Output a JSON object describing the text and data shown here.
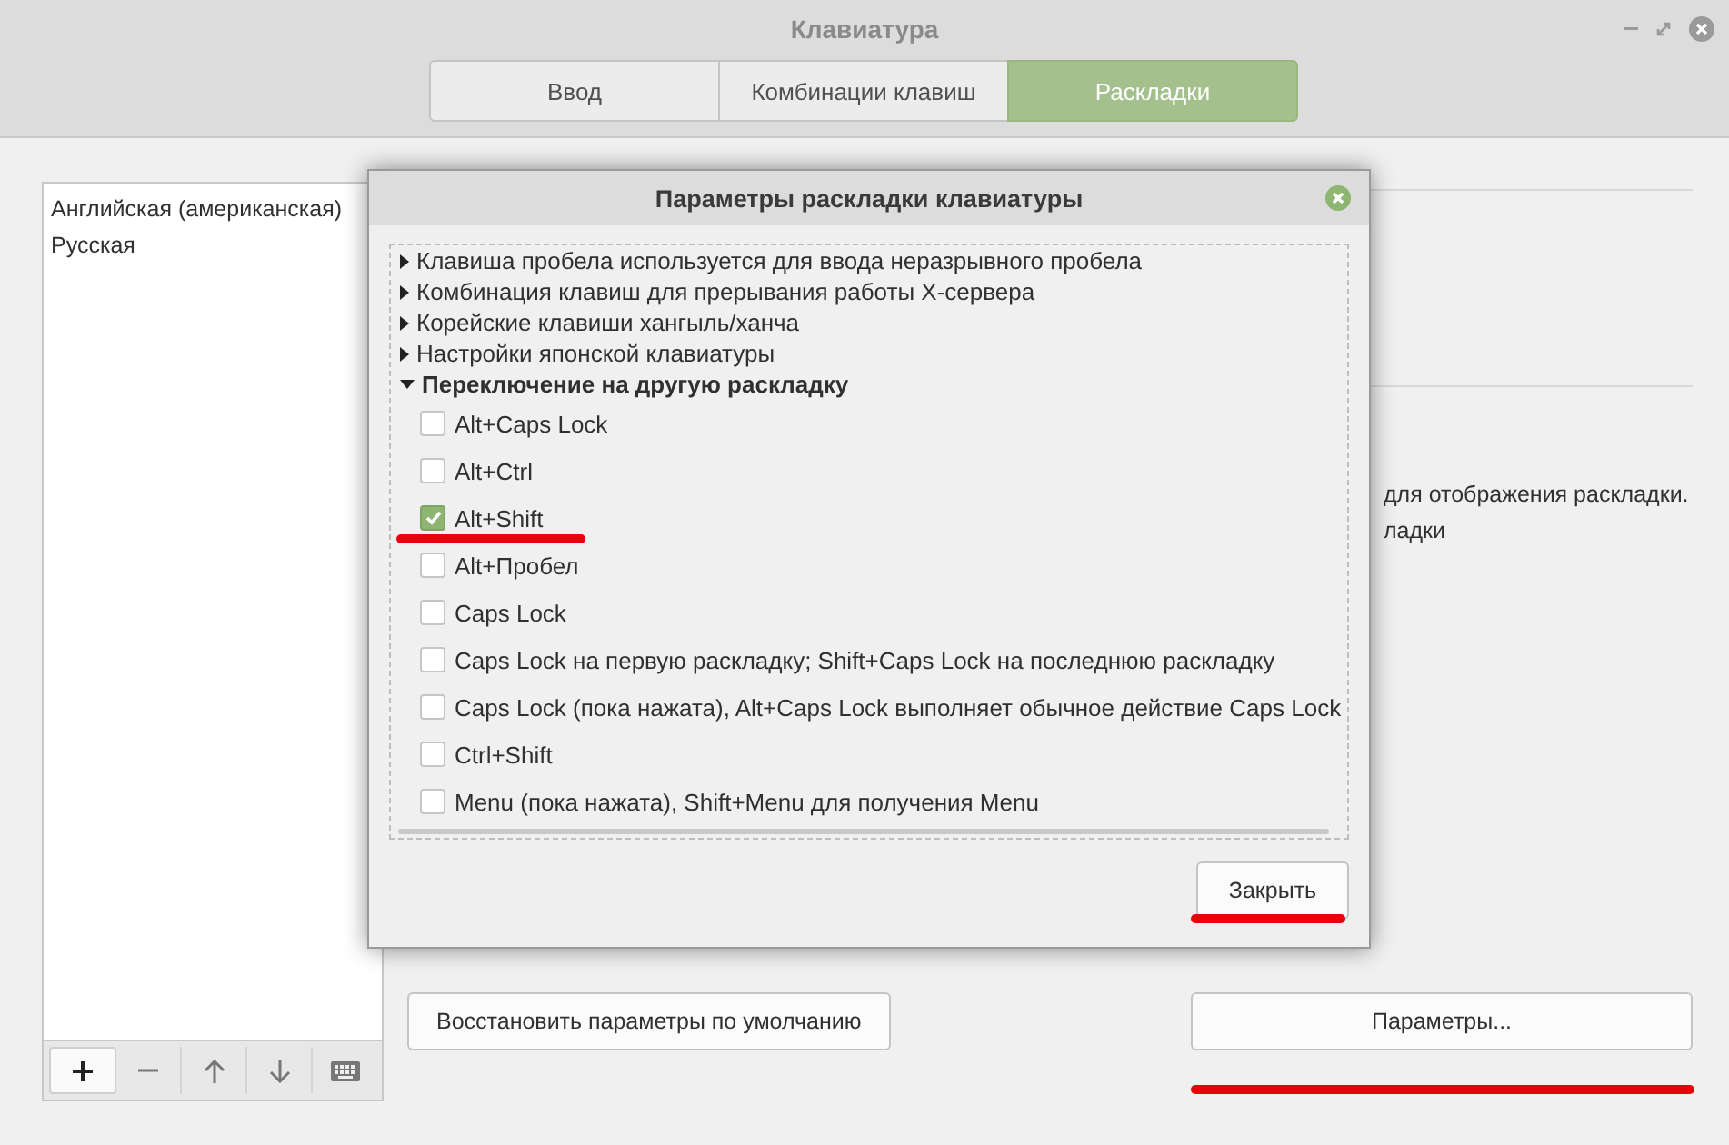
{
  "window": {
    "title": "Клавиатура"
  },
  "tabs": [
    {
      "label": "Ввод",
      "selected": false
    },
    {
      "label": "Комбинации клавиш",
      "selected": false
    },
    {
      "label": "Раскладки",
      "selected": true
    }
  ],
  "layouts": [
    {
      "label": "Английская (американская)",
      "selected": false
    },
    {
      "label": "Русская",
      "selected": false
    }
  ],
  "background_text": [
    "для отображения раскладки.",
    "ладки"
  ],
  "restore_button": "Восстановить параметры по умолчанию",
  "options_button": "Параметры...",
  "dialog": {
    "title": "Параметры раскладки клавиатуры",
    "tree": [
      {
        "label": "Клавиша пробела используется для ввода неразрывного пробела",
        "expanded": false
      },
      {
        "label": "Комбинация клавиш для прерывания работы X-сервера",
        "expanded": false
      },
      {
        "label": "Корейские клавиши хангыль/ханча",
        "expanded": false
      },
      {
        "label": "Настройки японской клавиатуры",
        "expanded": false
      },
      {
        "label": "Переключение на другую раскладку",
        "expanded": true,
        "children": [
          {
            "label": "Alt+Caps Lock",
            "checked": false
          },
          {
            "label": "Alt+Ctrl",
            "checked": false
          },
          {
            "label": "Alt+Shift",
            "checked": true
          },
          {
            "label": "Alt+Пробел",
            "checked": false
          },
          {
            "label": "Caps Lock",
            "checked": false
          },
          {
            "label": "Caps Lock на первую раскладку; Shift+Caps Lock на последнюю раскладку",
            "checked": false
          },
          {
            "label": "Caps Lock (пока нажата), Alt+Caps Lock выполняет обычное действие Caps Lock",
            "checked": false
          },
          {
            "label": "Ctrl+Shift",
            "checked": false
          },
          {
            "label": "Menu (пока нажата), Shift+Menu для получения Menu",
            "checked": false
          }
        ]
      }
    ],
    "close_button": "Закрыть"
  }
}
